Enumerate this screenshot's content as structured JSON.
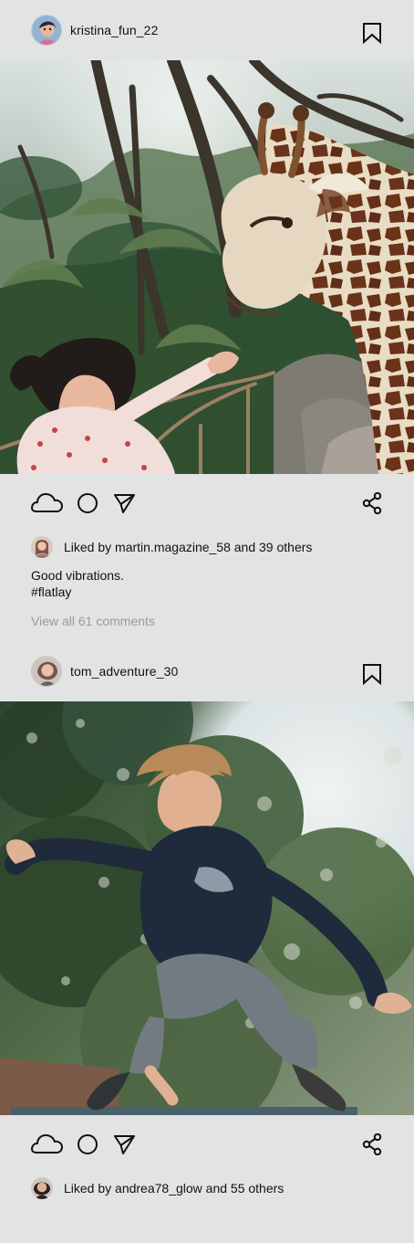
{
  "posts": [
    {
      "username": "kristina_fun_22",
      "likes_text": "Liked by martin.magazine_58 and 39 others",
      "caption_lines": [
        "Good vibrations.",
        "#flatlay"
      ],
      "comments_text": "View all 61 comments",
      "image_alt": "Child feeding a giraffe in a tropical zoo enclosure"
    },
    {
      "username": "tom_adventure_30",
      "likes_text": "Liked by andrea78_glow and 55 others"
    }
  ],
  "icons": {
    "bookmark": "bookmark-icon",
    "cloud": "cloud-icon",
    "circle": "circle-icon",
    "send": "send-icon",
    "share": "share-icon"
  },
  "colors": {
    "page_background": "#e2e4e3",
    "muted_text": "#9a9a9a",
    "text": "#111111"
  }
}
